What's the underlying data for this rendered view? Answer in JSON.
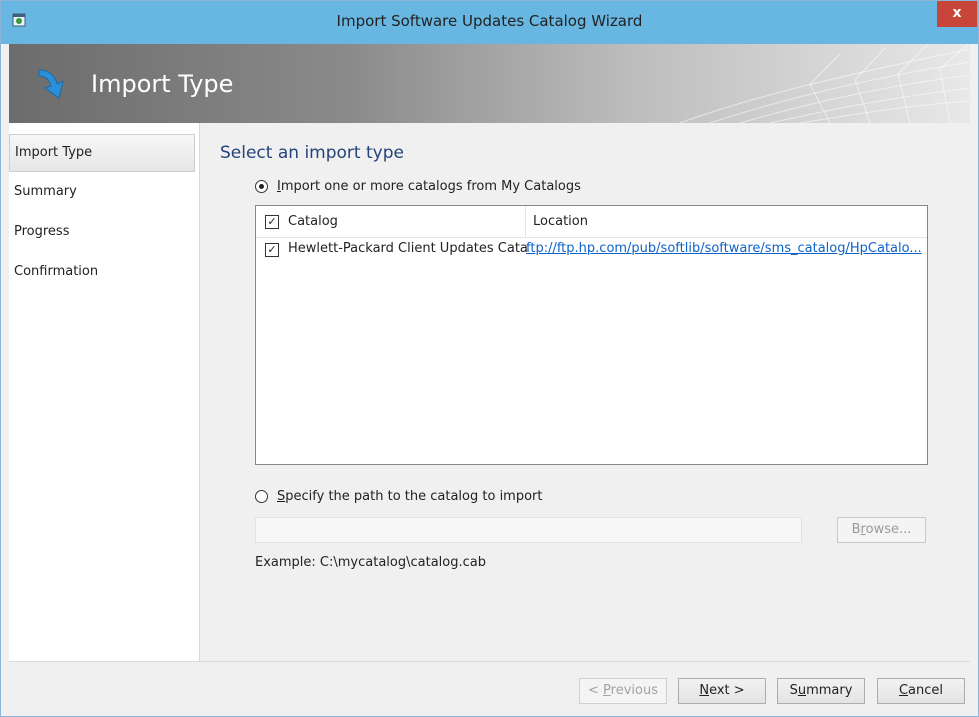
{
  "window": {
    "title": "Import Software Updates Catalog Wizard",
    "close_label": "x"
  },
  "header": {
    "title": "Import Type"
  },
  "sidebar": {
    "items": [
      {
        "label": "Import Type"
      },
      {
        "label": "Summary"
      },
      {
        "label": "Progress"
      },
      {
        "label": "Confirmation"
      }
    ]
  },
  "content": {
    "section_title": "Select an import type",
    "option1": {
      "accel": "I",
      "label_rest": "mport one or more catalogs from My Catalogs",
      "checked": true
    },
    "grid": {
      "headers": [
        "Catalog",
        "Location"
      ],
      "rows": [
        {
          "catalog": "Hewlett-Packard Client Updates Cata",
          "location": "ftp://ftp.hp.com/pub/softlib/software/sms_catalog/HpCatalo...",
          "checked": true
        }
      ]
    },
    "option2": {
      "accel": "S",
      "label_rest": "pecify the path to the catalog to import",
      "checked": false
    },
    "path_value": "",
    "browse": {
      "pre": "B",
      "accel": "r",
      "post": "owse..."
    },
    "example": "Example: C:\\mycatalog\\catalog.cab"
  },
  "footer": {
    "previous": {
      "pre": "< ",
      "accel": "P",
      "post": "revious"
    },
    "next": {
      "accel": "N",
      "post": "ext >"
    },
    "summary": {
      "pre": "S",
      "accel": "u",
      "post": "mmary"
    },
    "cancel": {
      "accel": "C",
      "post": "ancel"
    }
  },
  "colors": {
    "titlebar": "#68b7e2",
    "accent_blue": "#25437b",
    "link": "#0d63c9",
    "close": "#c8453a"
  },
  "icons": [
    "wizard-app-icon",
    "import-arrow-icon",
    "radio-checked-icon",
    "radio-unchecked-icon",
    "checkbox-checked-icon"
  ]
}
